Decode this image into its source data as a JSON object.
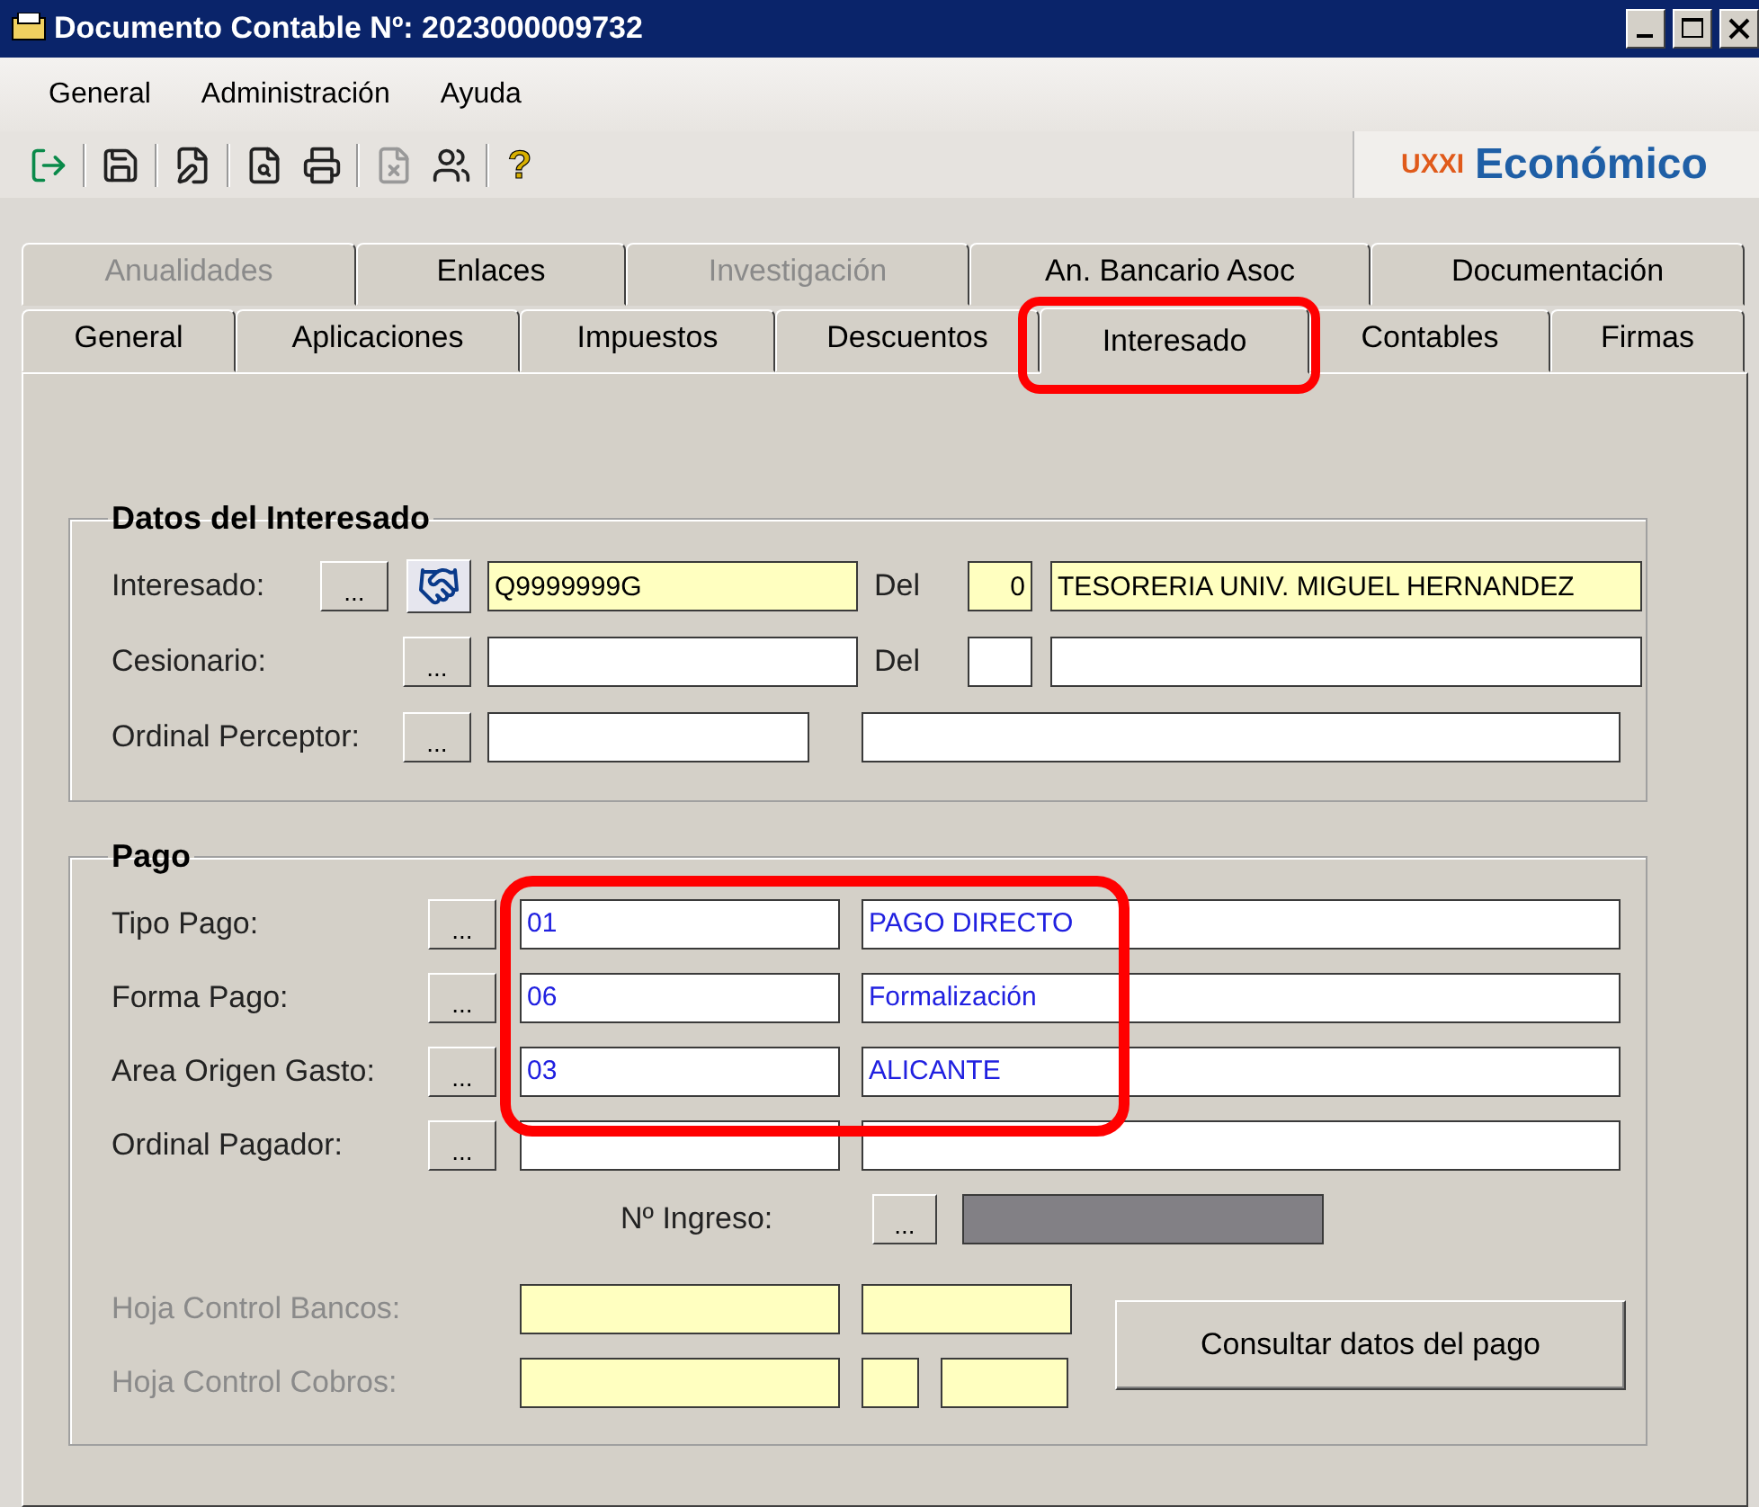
{
  "window": {
    "title": "Documento Contable Nº: 2023000009732"
  },
  "menu": [
    "General",
    "Administración",
    "Ayuda"
  ],
  "toolbar": {
    "help_glyph": "?",
    "logo_prefix": "UXXI",
    "logo": "Económico"
  },
  "tabs_back": [
    {
      "label": "Anualidades",
      "disabled": true
    },
    {
      "label": "Enlaces",
      "disabled": false
    },
    {
      "label": "Investigación",
      "disabled": true
    },
    {
      "label": "An. Bancario Asoc",
      "disabled": false
    },
    {
      "label": "Documentación",
      "disabled": false
    }
  ],
  "tabs_front": [
    {
      "label": "General",
      "selected": false,
      "highlighted": false
    },
    {
      "label": "Aplicaciones",
      "selected": false,
      "highlighted": false
    },
    {
      "label": "Impuestos",
      "selected": false,
      "highlighted": false
    },
    {
      "label": "Descuentos",
      "selected": false,
      "highlighted": false
    },
    {
      "label": "Interesado",
      "selected": true,
      "highlighted": true
    },
    {
      "label": "Contables",
      "selected": false,
      "highlighted": false
    },
    {
      "label": "Firmas",
      "selected": false,
      "highlighted": false
    }
  ],
  "interesado": {
    "title": "Datos del Interesado",
    "rows": [
      {
        "kind": "del",
        "label": "Interesado:",
        "button": "...",
        "handshake": true,
        "readonly": true,
        "code": "Q9999999G",
        "del_label": "Del",
        "del": "0",
        "name": "TESORERIA UNIV. MIGUEL HERNANDEZ"
      },
      {
        "kind": "del",
        "label": "Cesionario:",
        "button": "...",
        "handshake": false,
        "readonly": false,
        "del_label": "Del"
      },
      {
        "kind": "plain",
        "label": "Ordinal Perceptor:",
        "button": "...",
        "handshake": false,
        "readonly": false
      }
    ]
  },
  "pago": {
    "title": "Pago",
    "rows": [
      {
        "label": "Tipo Pago:",
        "button": "...",
        "code": "01",
        "name": "PAGO DIRECTO",
        "annotated": true
      },
      {
        "label": "Forma Pago:",
        "button": "...",
        "code": "06",
        "name": "Formalización",
        "annotated": true
      },
      {
        "label": "Area Origen Gasto:",
        "button": "...",
        "code": "03",
        "name": "ALICANTE",
        "annotated": true
      },
      {
        "label": "Ordinal Pagador:",
        "button": "...",
        "annotated": false
      }
    ],
    "ingreso": {
      "label": "Nº Ingreso:",
      "button": "...",
      "disabled": true
    },
    "hojas": [
      {
        "label": "Hoja Control Bancos:",
        "disabled": true,
        "kind": "two"
      },
      {
        "label": "Hoja Control Cobros:",
        "disabled": true,
        "kind": "three"
      }
    ],
    "action": "Consultar datos del pago"
  }
}
